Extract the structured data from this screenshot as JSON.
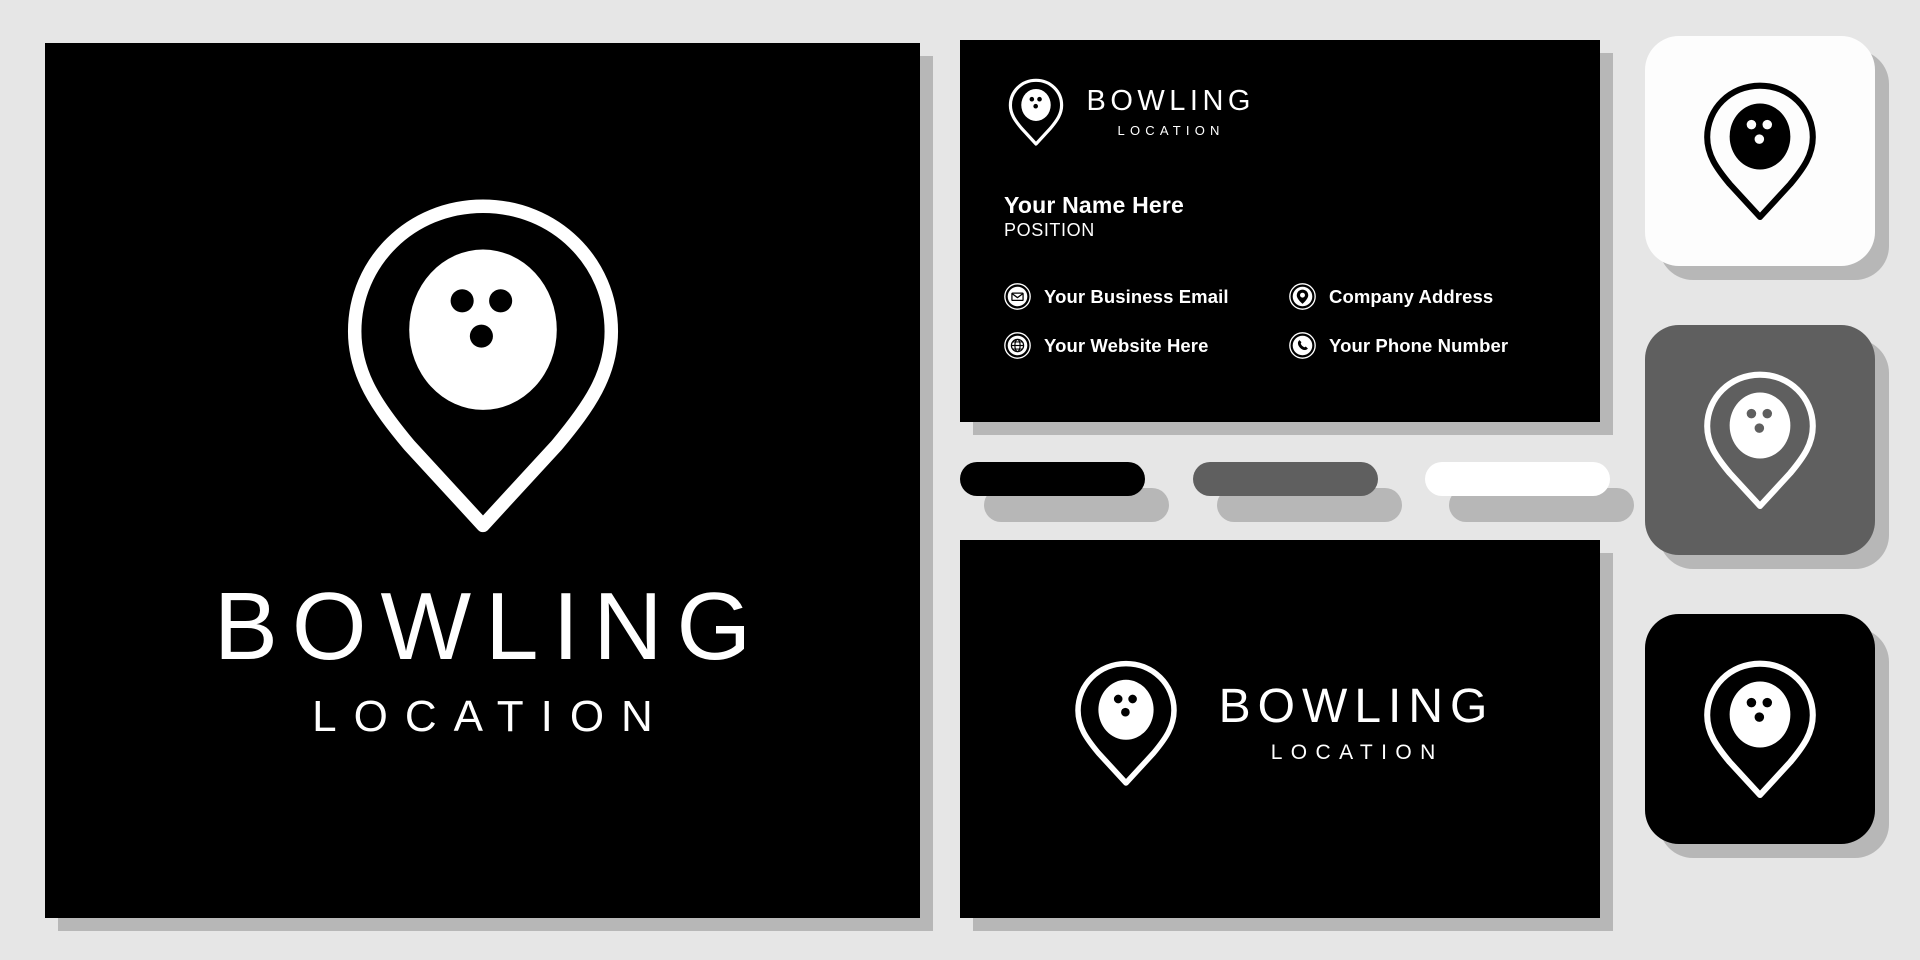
{
  "brand": {
    "name": "BOWLING",
    "tagline": "LOCATION",
    "mark_name": "map-pin-bowling-ball-logo"
  },
  "colors": {
    "background": "#e6e6e6",
    "shadow": "#b7b7b7",
    "black": "#000000",
    "gray": "#5f5f5f",
    "white": "#ffffff"
  },
  "hero": {
    "title": "BOWLING",
    "subtitle": "LOCATION"
  },
  "business_card": {
    "logo_title": "BOWLING",
    "logo_subtitle": "LOCATION",
    "name": "Your Name Here",
    "position": "POSITION",
    "contacts": [
      {
        "icon": "envelope-icon",
        "label": "Your Business Email"
      },
      {
        "icon": "map-pin-icon",
        "label": "Company Address"
      },
      {
        "icon": "globe-icon",
        "label": "Your Website Here"
      },
      {
        "icon": "phone-icon",
        "label": "Your Phone Number"
      }
    ]
  },
  "palette": {
    "swatches": [
      {
        "name": "swatch-black",
        "color": "#000000"
      },
      {
        "name": "swatch-gray",
        "color": "#5f5f5f"
      },
      {
        "name": "swatch-white",
        "color": "#ffffff"
      }
    ]
  },
  "bottom_card": {
    "title": "BOWLING",
    "subtitle": "LOCATION"
  },
  "tiles": [
    {
      "name": "app-icon-light",
      "background": "#fdfdfd",
      "mark_color": "#000000",
      "ball_fill": "#000000",
      "hole_color": "#fdfdfd"
    },
    {
      "name": "app-icon-gray",
      "background": "#5f5f5f",
      "mark_color": "#ffffff",
      "ball_fill": "#ffffff",
      "hole_color": "#5f5f5f"
    },
    {
      "name": "app-icon-dark",
      "background": "#000000",
      "mark_color": "#ffffff",
      "ball_fill": "#ffffff",
      "hole_color": "#000000"
    }
  ]
}
